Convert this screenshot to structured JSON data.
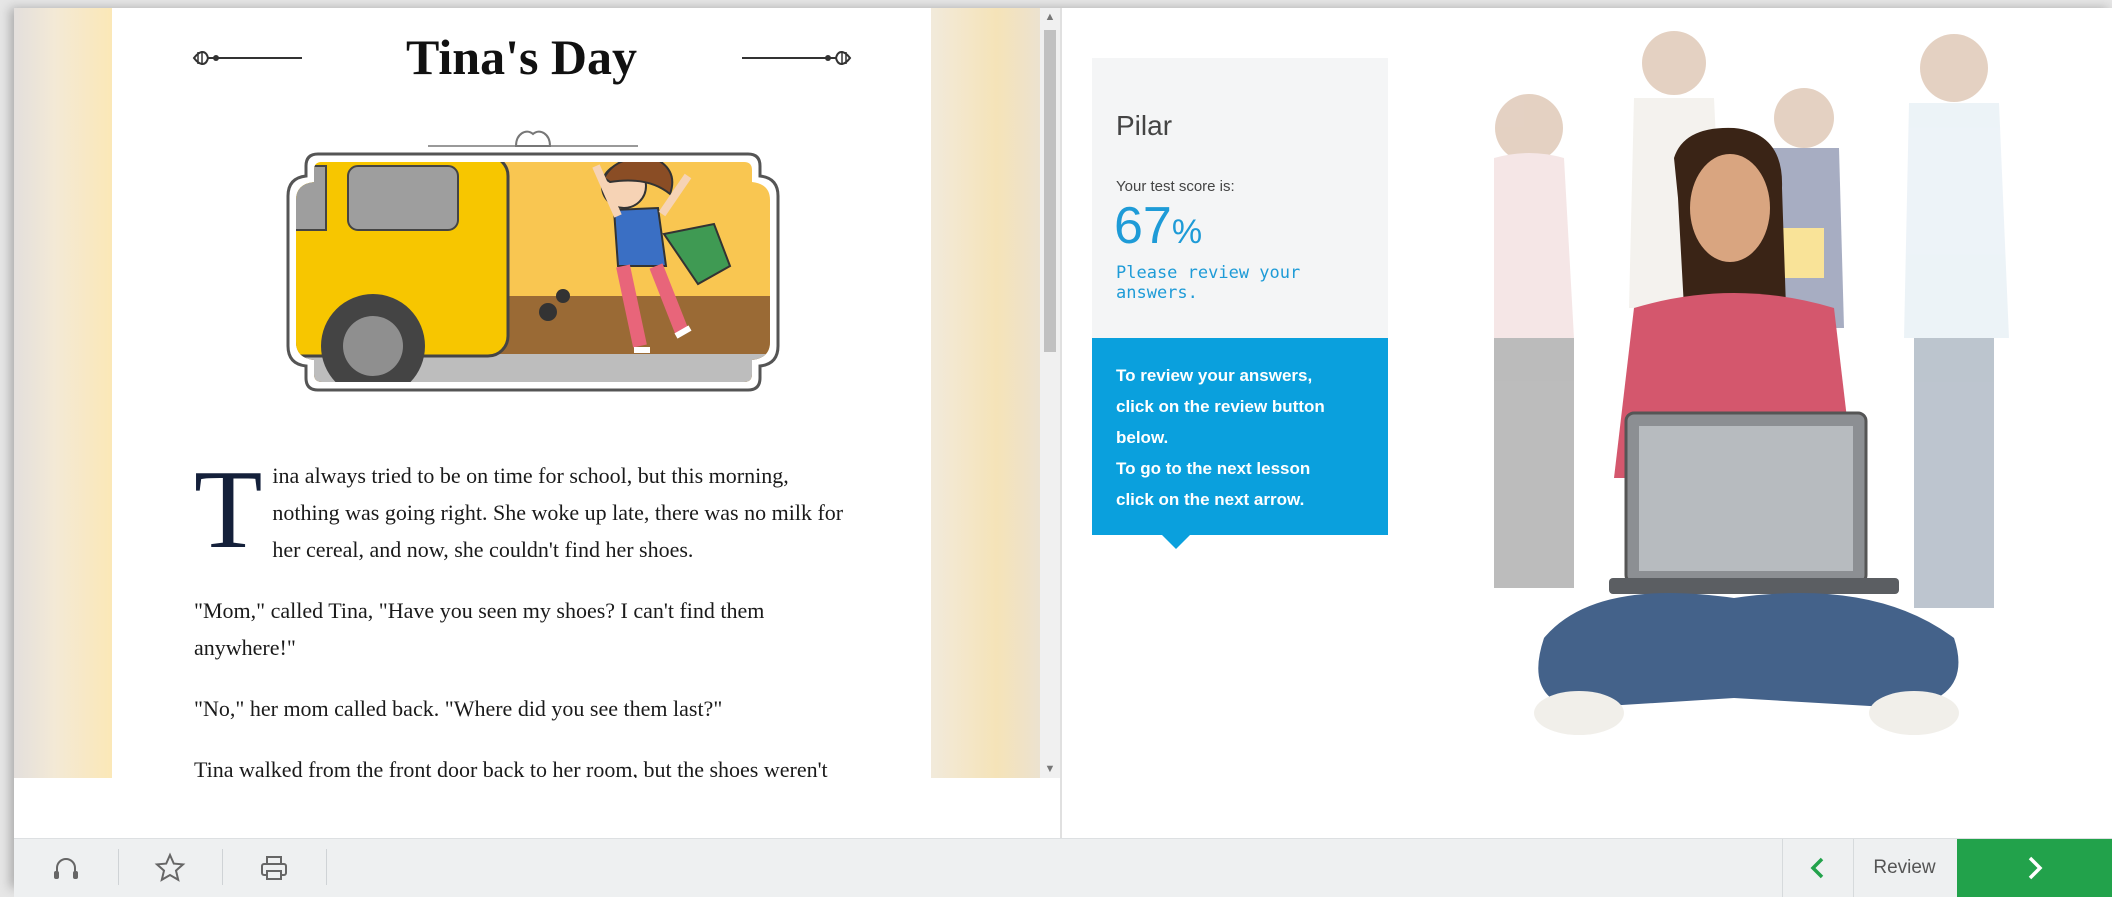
{
  "story": {
    "title": "Tina's Day",
    "dropcap": "T",
    "paragraphs": [
      "ina always tried to be on time for school, but this morning, nothing was going right. She woke up late, there was no milk for her cereal, and now, she couldn't find her shoes.",
      "\"Mom,\" called Tina, \"Have you seen my shoes? I can't find them anywhere!\"",
      "\"No,\" her mom called back. \"Where did you see them last?\"",
      "Tina walked from the front door back to her room, but the shoes weren't"
    ]
  },
  "result": {
    "student_name": "Pilar",
    "score_label": "Your test score is:",
    "score_number": "67",
    "score_unit": "%",
    "score_message": "Please review your answers.",
    "info_lines": [
      "To review your answers,",
      "click on the review button",
      "below.",
      "To go to the next lesson",
      "click on the next arrow."
    ]
  },
  "toolbar": {
    "icons": [
      "headphones-icon",
      "star-icon",
      "printer-icon"
    ],
    "review_label": "Review"
  },
  "colors": {
    "accent_blue": "#0aa0dd",
    "score_blue": "#1e9bd7",
    "next_green": "#22a24b"
  }
}
